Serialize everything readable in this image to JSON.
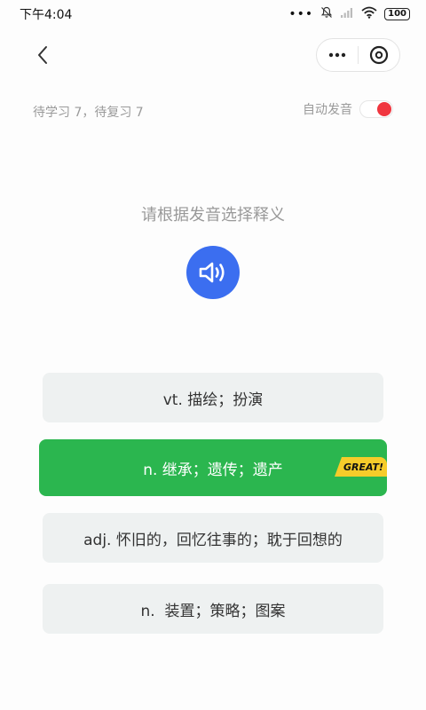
{
  "status_bar": {
    "time": "下午4:04",
    "dots": "•••",
    "battery": "100"
  },
  "nav": {
    "back_icon": "chevron-left-icon",
    "more_icon": "more-dots-icon",
    "close_icon": "close-circle-icon"
  },
  "progress": {
    "text": "待学习 7，待复习 7"
  },
  "auto_voice": {
    "label": "自动发音",
    "enabled": true,
    "knob_color": "#f0363f"
  },
  "question": {
    "prompt": "请根据发音选择释义",
    "speaker_icon": "speaker-icon",
    "speaker_color": "#3b6ef0"
  },
  "options": [
    {
      "label": "vt. 描绘；扮演",
      "state": "default"
    },
    {
      "label": "n. 继承；遗传；遗产",
      "state": "correct",
      "badge": "GREAT!"
    },
    {
      "label": "adj. 怀旧的，回忆往事的；耽于回想的",
      "state": "default"
    },
    {
      "label": "n.  装置；策略；图案",
      "state": "default"
    }
  ],
  "colors": {
    "correct_bg": "#2bb64f",
    "option_bg": "#eef1f1",
    "badge_bg": "#f6cc2a"
  }
}
